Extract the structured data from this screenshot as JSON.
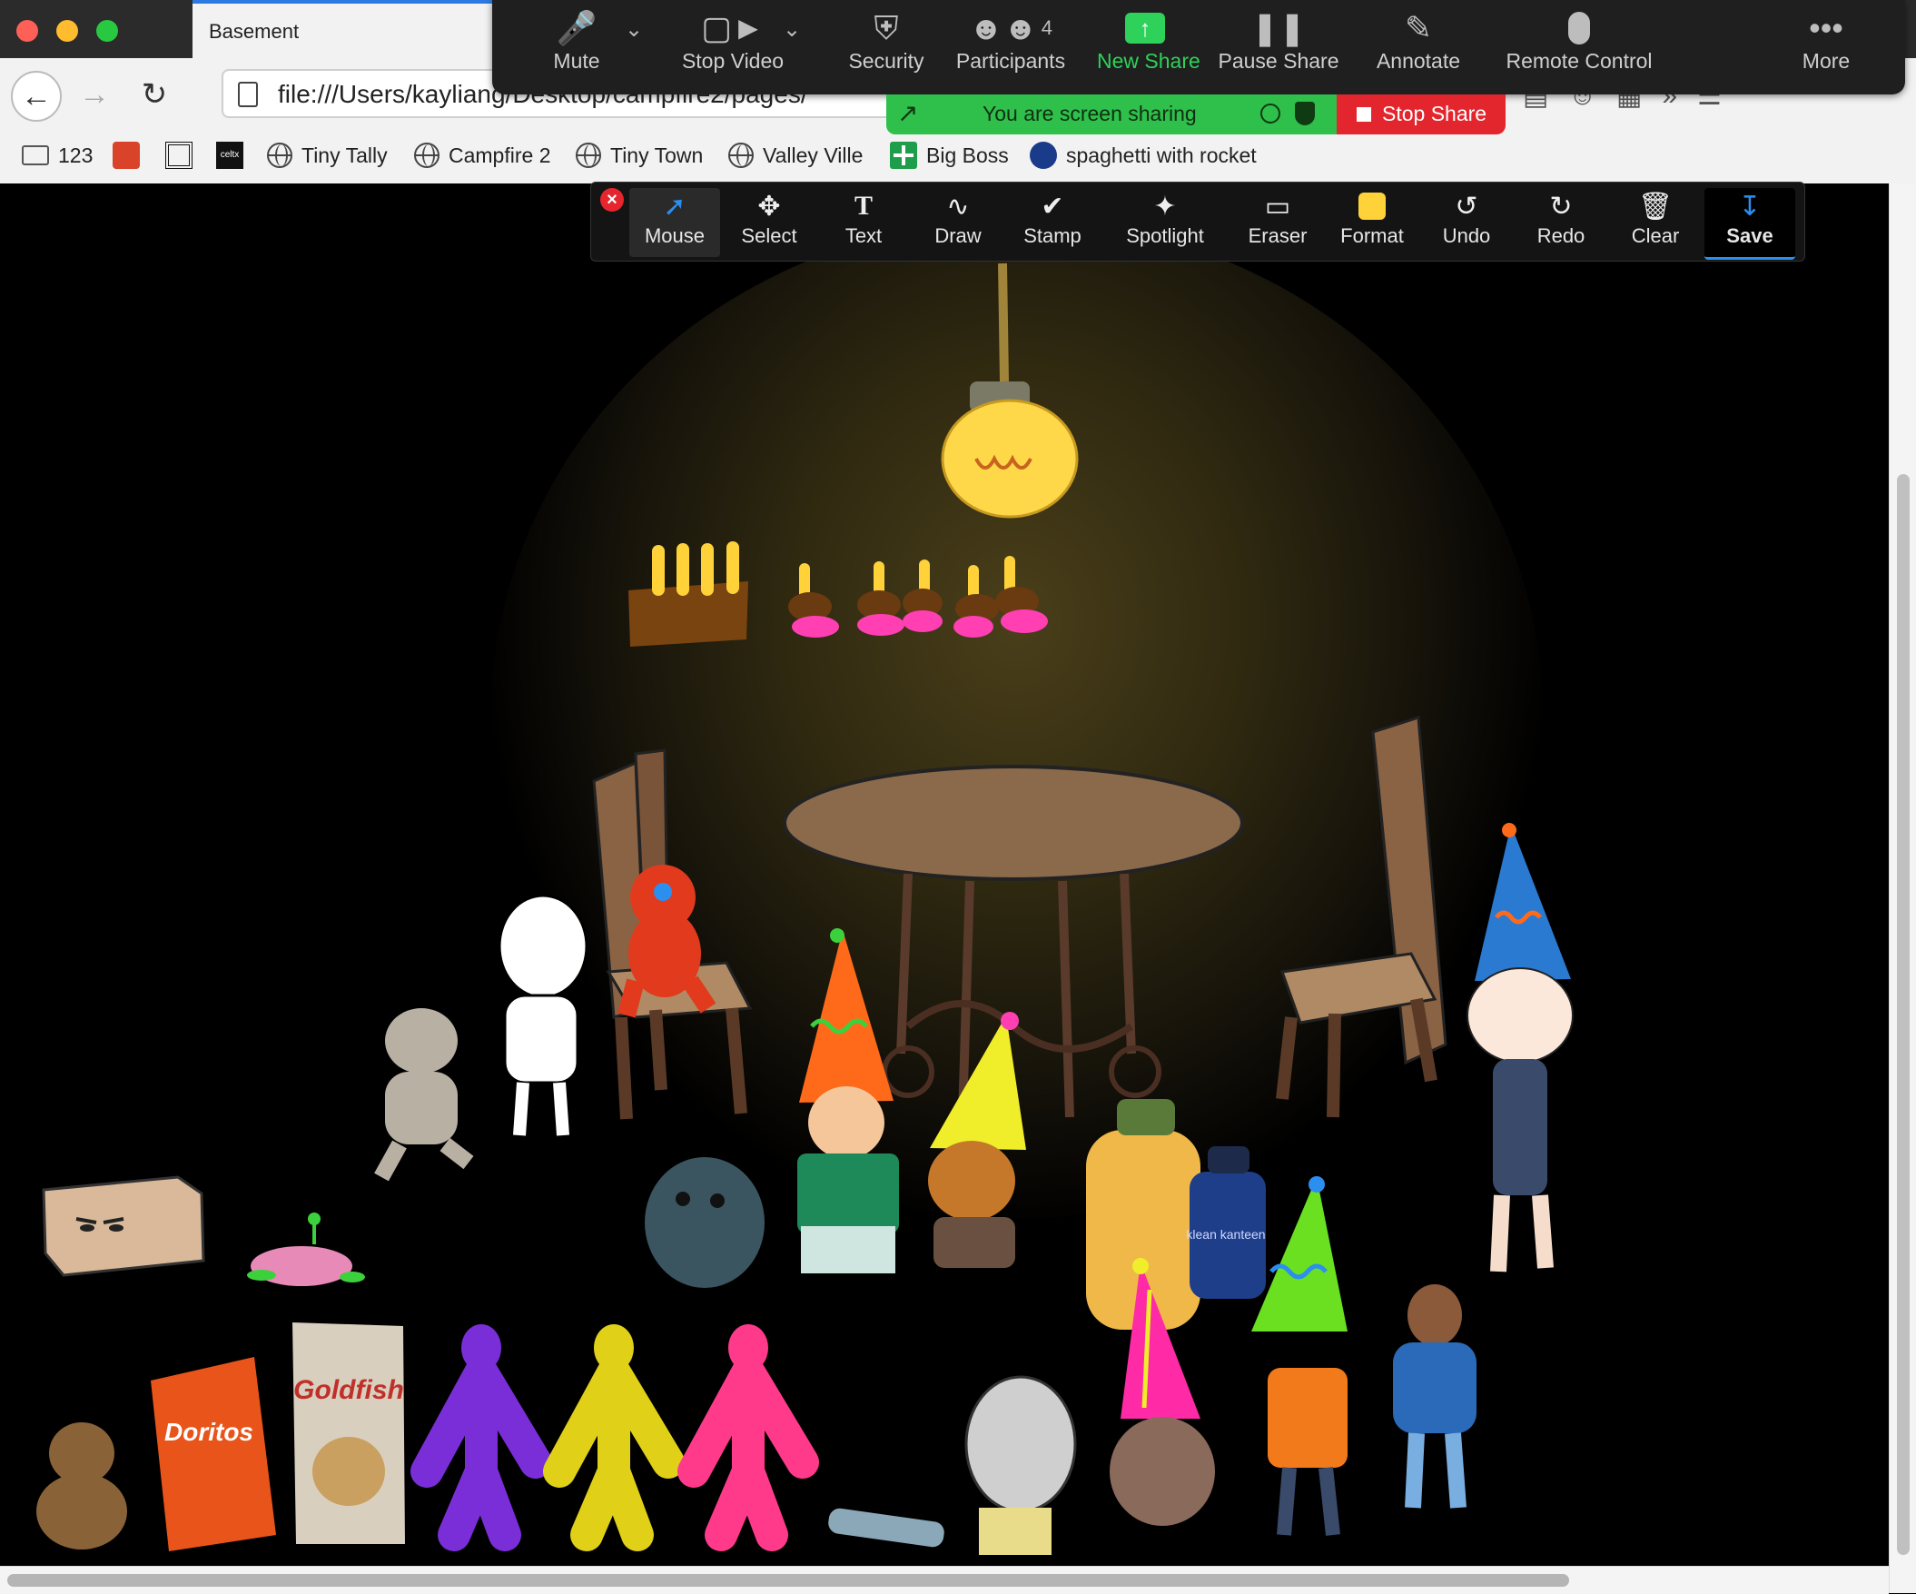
{
  "browser": {
    "tab_title": "Basement",
    "url": "file:///Users/kayliang/Desktop/campfire2/pages/",
    "bookmarks": [
      {
        "label": "123",
        "icon": "folder-icon"
      },
      {
        "label": "",
        "icon": "fox-favicon"
      },
      {
        "label": "",
        "icon": "square-favicon"
      },
      {
        "label": "",
        "icon": "celtx-favicon",
        "badge_text": "celtx"
      },
      {
        "label": "Tiny Tally",
        "icon": "globe-icon"
      },
      {
        "label": "Campfire 2",
        "icon": "globe-icon"
      },
      {
        "label": "Tiny Town",
        "icon": "globe-icon"
      },
      {
        "label": "Valley Ville",
        "icon": "globe-icon"
      },
      {
        "label": "Big Boss",
        "icon": "sheets-icon"
      },
      {
        "label": "spaghetti with rocket",
        "icon": "g-icon"
      }
    ]
  },
  "zoom": {
    "participants_count": "4",
    "buttons": [
      {
        "label": "Mute",
        "icon": "microphone-icon"
      },
      {
        "label": "Stop Video",
        "icon": "video-camera-icon"
      },
      {
        "label": "Security",
        "icon": "shield-icon"
      },
      {
        "label": "Participants",
        "icon": "participants-icon"
      },
      {
        "label": "New Share",
        "icon": "share-arrow-icon"
      },
      {
        "label": "Pause Share",
        "icon": "pause-icon"
      },
      {
        "label": "Annotate",
        "icon": "pencil-icon"
      },
      {
        "label": "Remote Control",
        "icon": "mouse-icon"
      },
      {
        "label": "More",
        "icon": "more-dots-icon"
      }
    ],
    "sharing_text": "You are screen sharing",
    "stop_share_label": "Stop Share",
    "colors": {
      "share_green": "#2fbf4b",
      "stop_red": "#e3262e",
      "new_share_green": "#2ed15a"
    }
  },
  "annotation": {
    "tools": [
      {
        "label": "Mouse",
        "icon": "cursor-arrow-icon"
      },
      {
        "label": "Select",
        "icon": "move-arrows-icon"
      },
      {
        "label": "Text",
        "icon": "text-t-icon"
      },
      {
        "label": "Draw",
        "icon": "wave-icon"
      },
      {
        "label": "Stamp",
        "icon": "checkmark-icon"
      },
      {
        "label": "Spotlight",
        "icon": "magic-wand-icon"
      },
      {
        "label": "Eraser",
        "icon": "eraser-icon"
      },
      {
        "label": "Format",
        "icon": "color-square-icon"
      },
      {
        "label": "Undo",
        "icon": "undo-icon"
      },
      {
        "label": "Redo",
        "icon": "redo-icon"
      },
      {
        "label": "Clear",
        "icon": "trash-icon"
      },
      {
        "label": "Save",
        "icon": "save-download-icon"
      }
    ],
    "format_color": "#ffd23a"
  },
  "scene": {
    "snack_labels": {
      "doritos": "Doritos",
      "goldfish": "Goldfish"
    },
    "bottle_label": "klean kanteen"
  }
}
